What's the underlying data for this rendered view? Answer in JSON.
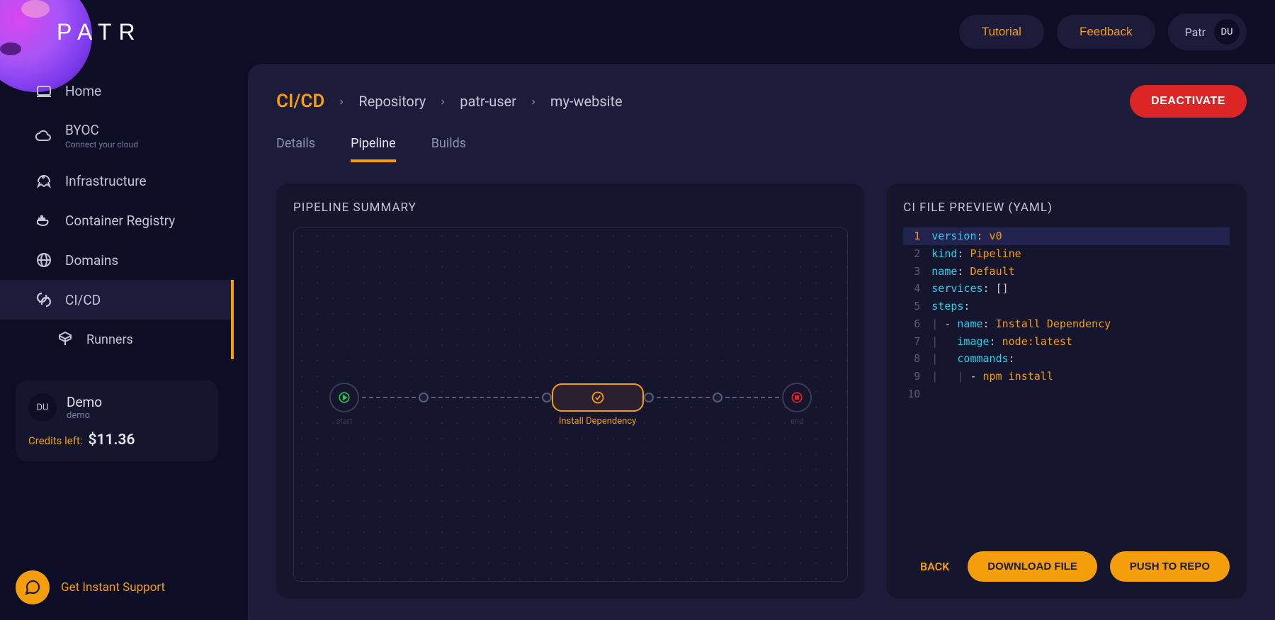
{
  "brand": {
    "name": "PATR"
  },
  "header": {
    "tutorial": "Tutorial",
    "feedback": "Feedback",
    "workspace": "Patr",
    "avatar_initials": "DU"
  },
  "sidebar": {
    "items": [
      {
        "id": "home",
        "label": "Home"
      },
      {
        "id": "byoc",
        "label": "BYOC",
        "sub": "Connect your cloud"
      },
      {
        "id": "infrastructure",
        "label": "Infrastructure"
      },
      {
        "id": "container-registry",
        "label": "Container Registry"
      },
      {
        "id": "domains",
        "label": "Domains"
      },
      {
        "id": "cicd",
        "label": "CI/CD",
        "active": true
      },
      {
        "id": "runners",
        "label": "Runners",
        "indent": true
      }
    ],
    "user_card": {
      "initials": "DU",
      "name": "Demo",
      "handle": "demo",
      "credits_label": "Credits left:",
      "credits_value": "$11.36"
    },
    "support": "Get Instant Support"
  },
  "breadcrumb": {
    "root": "CI/CD",
    "items": [
      "Repository",
      "patr-user",
      "my-website"
    ]
  },
  "deactivate": "DEACTIVATE",
  "tabs": [
    {
      "id": "details",
      "label": "Details"
    },
    {
      "id": "pipeline",
      "label": "Pipeline",
      "active": true
    },
    {
      "id": "builds",
      "label": "Builds"
    }
  ],
  "pipeline": {
    "title": "PIPELINE SUMMARY",
    "start_label": "start",
    "end_label": "end",
    "step": "Install Dependency"
  },
  "yaml_panel": {
    "title": "CI FILE PREVIEW (YAML)",
    "lines": [
      {
        "n": 1,
        "hl": true,
        "tokens": [
          [
            "key",
            "version"
          ],
          [
            "punc",
            ": "
          ],
          [
            "val",
            "v0"
          ]
        ]
      },
      {
        "n": 2,
        "tokens": [
          [
            "key",
            "kind"
          ],
          [
            "punc",
            ": "
          ],
          [
            "val",
            "Pipeline"
          ]
        ]
      },
      {
        "n": 3,
        "tokens": [
          [
            "key",
            "name"
          ],
          [
            "punc",
            ": "
          ],
          [
            "val",
            "Default"
          ]
        ]
      },
      {
        "n": 4,
        "tokens": [
          [
            "key",
            "services"
          ],
          [
            "punc",
            ": []"
          ]
        ]
      },
      {
        "n": 5,
        "tokens": [
          [
            "key",
            "steps"
          ],
          [
            "punc",
            ":"
          ]
        ]
      },
      {
        "n": 6,
        "tokens": [
          [
            "guide",
            "| "
          ],
          [
            "punc",
            "- "
          ],
          [
            "key",
            "name"
          ],
          [
            "punc",
            ": "
          ],
          [
            "val",
            "Install Dependency"
          ]
        ]
      },
      {
        "n": 7,
        "tokens": [
          [
            "guide",
            "|   "
          ],
          [
            "key",
            "image"
          ],
          [
            "punc",
            ": "
          ],
          [
            "val",
            "node:latest"
          ]
        ]
      },
      {
        "n": 8,
        "tokens": [
          [
            "guide",
            "|   "
          ],
          [
            "key",
            "commands"
          ],
          [
            "punc",
            ":"
          ]
        ]
      },
      {
        "n": 9,
        "tokens": [
          [
            "guide",
            "|   | "
          ],
          [
            "punc",
            "- "
          ],
          [
            "val",
            "npm install"
          ]
        ]
      },
      {
        "n": 10,
        "tokens": []
      }
    ]
  },
  "actions": {
    "back": "BACK",
    "download": "DOWNLOAD FILE",
    "push": "PUSH TO REPO"
  }
}
